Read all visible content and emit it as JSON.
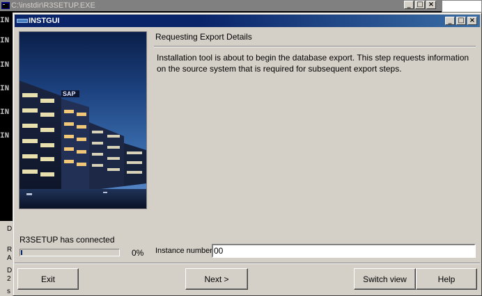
{
  "background_window": {
    "title": "C:\\instdir\\R3SETUP.EXE",
    "console_lines": [
      "IN",
      "IN",
      "IN",
      "IN",
      "IN",
      "IN"
    ],
    "lower_fragments": [
      "D",
      "R",
      "A",
      "D",
      "2",
      "s"
    ]
  },
  "dialog": {
    "title": "INSTGUI",
    "section_title": "Requesting Export Details",
    "description": "Installation tool is about to begin the database export. This step requests information on the source system that is required for subsequent export steps.",
    "status_text": "R3SETUP has connected",
    "progress": {
      "percent_label": "0%",
      "fraction": 0.0
    },
    "instance_number": {
      "label": "Instance number",
      "value": "00"
    },
    "buttons": {
      "exit": "Exit",
      "next": "Next >",
      "switch_view": "Switch view",
      "help": "Help"
    },
    "photo_sign": "SAP"
  },
  "window_controls": {
    "minimize": "_",
    "maximize": "□",
    "close": "×"
  },
  "colors": {
    "titlebar_active": "#0a246a",
    "face": "#d4d0c8",
    "console_bg": "#000000"
  }
}
